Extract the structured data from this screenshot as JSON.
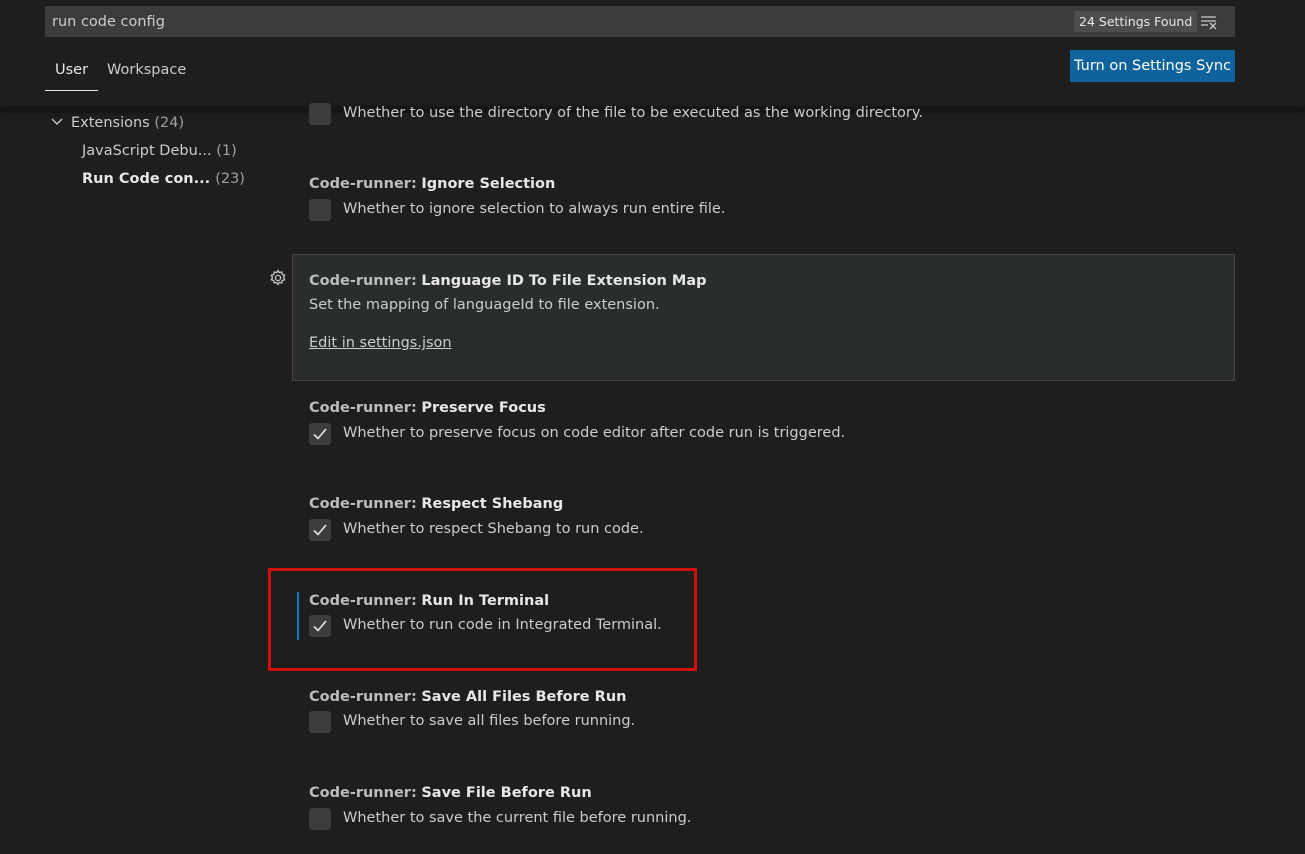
{
  "search": {
    "value": "run code config",
    "results_count": "24 Settings Found",
    "clear_icon": "clear-filter-icon"
  },
  "tabs": [
    {
      "label": "User",
      "active": true
    },
    {
      "label": "Workspace",
      "active": false
    }
  ],
  "sync_button": {
    "label": "Turn on Settings Sync",
    "color": "#0e639c"
  },
  "toc": {
    "extensions": {
      "label": "Extensions",
      "count": "(24)"
    },
    "items": [
      {
        "label": "JavaScript Debu...",
        "count": "(1)"
      },
      {
        "label": "Run Code con...",
        "count": "(23)",
        "active": true
      }
    ]
  },
  "settings": [
    {
      "id": "file-directory-as-cwd",
      "description": "Whether to use the directory of the file to be executed as the working directory.",
      "checked": false
    },
    {
      "id": "ignore-selection",
      "category": "Code-runner:",
      "label": "Ignore Selection",
      "description": "Whether to ignore selection to always run entire file.",
      "checked": false
    },
    {
      "id": "language-id-map",
      "category": "Code-runner:",
      "label": "Language ID To File Extension Map",
      "description": "Set the mapping of languageId to file extension.",
      "link": "Edit in settings.json"
    },
    {
      "id": "preserve-focus",
      "category": "Code-runner:",
      "label": "Preserve Focus",
      "description": "Whether to preserve focus on code editor after code run is triggered.",
      "checked": true
    },
    {
      "id": "respect-shebang",
      "category": "Code-runner:",
      "label": "Respect Shebang",
      "description": "Whether to respect Shebang to run code.",
      "checked": true
    },
    {
      "id": "run-in-terminal",
      "category": "Code-runner:",
      "label": "Run In Terminal",
      "description": "Whether to run code in Integrated Terminal.",
      "checked": true
    },
    {
      "id": "save-all-files",
      "category": "Code-runner:",
      "label": "Save All Files Before Run",
      "description": "Whether to save all files before running.",
      "checked": false
    },
    {
      "id": "save-file",
      "category": "Code-runner:",
      "label": "Save File Before Run",
      "description": "Whether to save the current file before running.",
      "checked": false
    }
  ],
  "colors": {
    "background": "#1e1e1e",
    "accent": "#0e639c",
    "highlight_outline": "#d10f0f",
    "focus_bar": "#0e7ac7"
  }
}
